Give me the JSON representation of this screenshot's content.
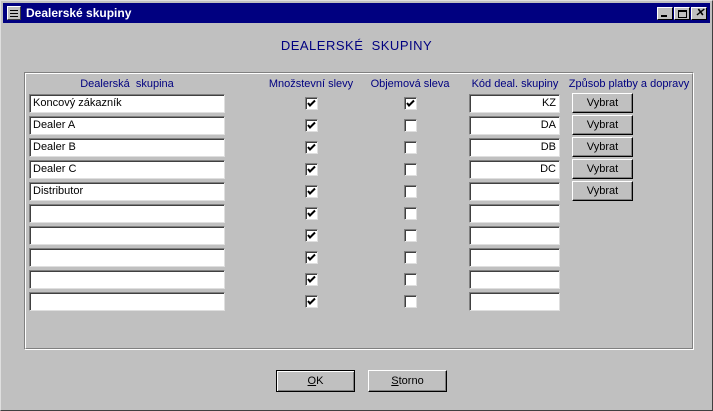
{
  "window": {
    "title": "Dealerské skupiny"
  },
  "heading": "DEALERSKÉ  SKUPINY",
  "columns": {
    "group": "Dealerská  skupina",
    "quantity_discount": "Množstevní slevy",
    "volume_discount": "Objemová sleva",
    "dealer_code": "Kód deal. skupiny",
    "payment": "Způsob platby a dopravy"
  },
  "rows": [
    {
      "name": "Koncový zákazník",
      "qty": true,
      "vol": true,
      "code": "KZ",
      "button": "Vybrat"
    },
    {
      "name": "Dealer A",
      "qty": true,
      "vol": false,
      "code": "DA",
      "button": "Vybrat"
    },
    {
      "name": "Dealer B",
      "qty": true,
      "vol": false,
      "code": "DB",
      "button": "Vybrat"
    },
    {
      "name": "Dealer C",
      "qty": true,
      "vol": false,
      "code": "DC",
      "button": "Vybrat"
    },
    {
      "name": "Distributor",
      "qty": true,
      "vol": false,
      "code": "",
      "button": "Vybrat"
    },
    {
      "name": "",
      "qty": true,
      "vol": false,
      "code": ""
    },
    {
      "name": "",
      "qty": true,
      "vol": false,
      "code": ""
    },
    {
      "name": "",
      "qty": true,
      "vol": false,
      "code": ""
    },
    {
      "name": "",
      "qty": true,
      "vol": false,
      "code": ""
    },
    {
      "name": "",
      "qty": true,
      "vol": false,
      "code": ""
    }
  ],
  "buttons": {
    "ok": {
      "first": "O",
      "rest": "K"
    },
    "storno": {
      "first": "S",
      "rest": "torno"
    }
  },
  "colors": {
    "title_bar": "#000080",
    "heading": "#000080",
    "face": "#c0c0c0"
  }
}
